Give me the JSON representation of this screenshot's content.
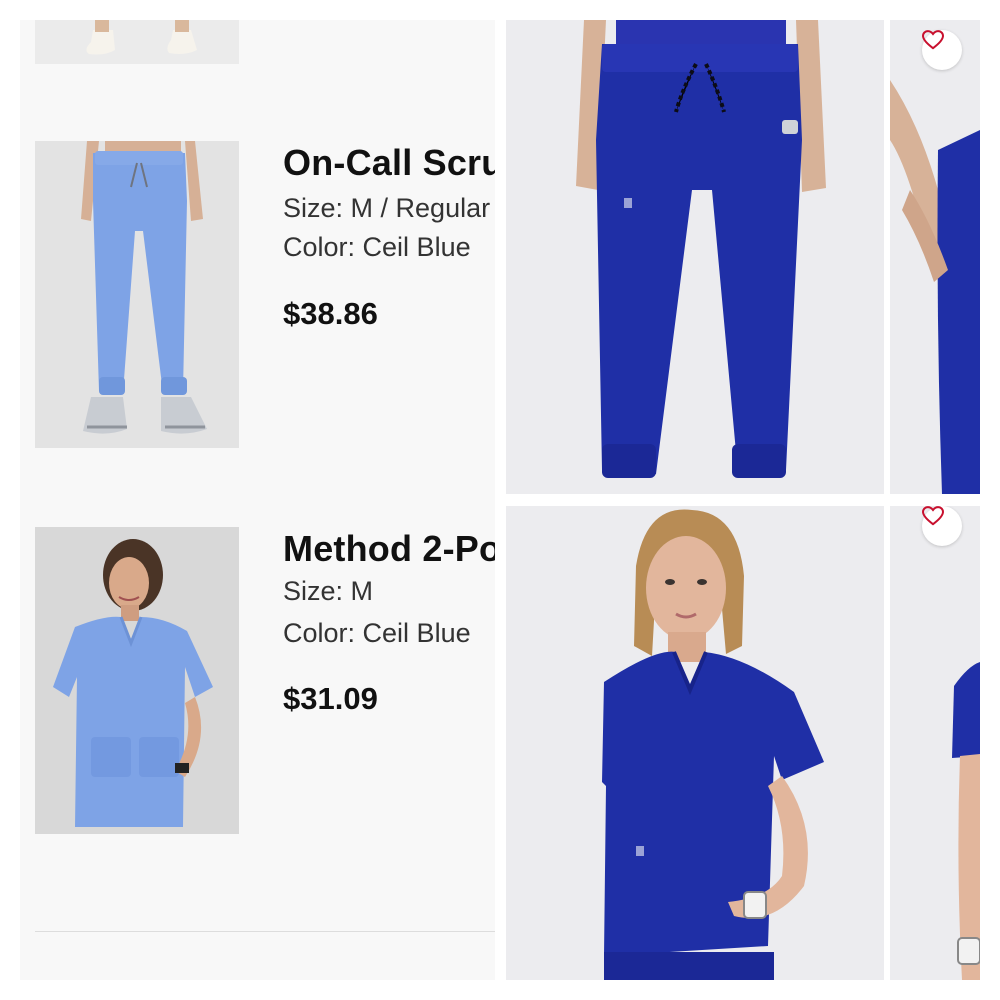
{
  "cart": {
    "items": [
      {
        "name": "On-Call Scru",
        "size_label": "Size:",
        "size_value": "M / Regular",
        "color_label": "Color:",
        "color_value": "Ceil Blue",
        "price": "$38.86"
      },
      {
        "name": "Method 2-Po",
        "size_label": "Size:",
        "size_value": "M",
        "color_label": "Color:",
        "color_value": "Ceil Blue",
        "price": "$31.09"
      }
    ]
  },
  "colors": {
    "ceil_blue": "#7ea3e6",
    "navy_royal": "#1f2fa6",
    "favorite_heart": "#c8102e"
  },
  "icons": {
    "favorite": "heart-outline-icon"
  }
}
